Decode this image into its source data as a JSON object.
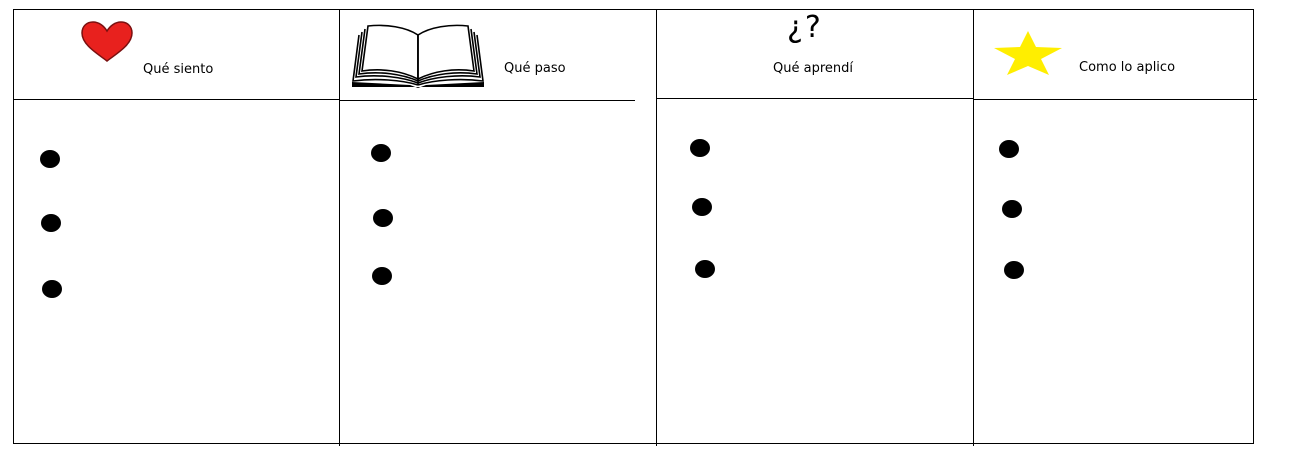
{
  "colors": {
    "lines": "#000000",
    "heart_fill": "#e8211e",
    "heart_outline": "#7a1010",
    "star_fill": "#ffee00",
    "bullets": "#000000"
  },
  "columns": [
    {
      "label": "Qué siento",
      "icon": "heart-icon",
      "bullet_count": 3
    },
    {
      "label": "Qué paso",
      "icon": "open-book-icon",
      "bullet_count": 3
    },
    {
      "label": "Qué aprendí",
      "icon": "question-marks-icon",
      "icon_text": "¿?",
      "bullet_count": 3
    },
    {
      "label": "Como lo aplico",
      "icon": "star-icon",
      "bullet_count": 3
    }
  ]
}
